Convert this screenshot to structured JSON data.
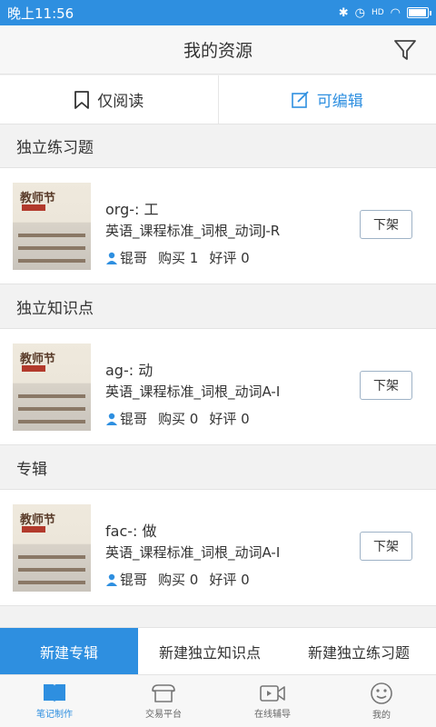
{
  "status_bar": {
    "time": "晚上11:56",
    "network": "HD"
  },
  "header": {
    "title": "我的资源"
  },
  "modes": [
    {
      "label": "仅阅读",
      "active": false
    },
    {
      "label": "可编辑",
      "active": true
    }
  ],
  "thumbnail": {
    "title_text": "教师节",
    "script_text": "节"
  },
  "sections": [
    {
      "title": "独立练习题",
      "items": [
        {
          "name": "org-: 工",
          "subtitle": "英语_课程标准_词根_动词J-R",
          "author": "锟哥",
          "purchases": "购买 1",
          "reviews": "好评 0",
          "button": "下架"
        }
      ]
    },
    {
      "title": "独立知识点",
      "items": [
        {
          "name": "ag-: 动",
          "subtitle": "英语_课程标准_词根_动词A-I",
          "author": "锟哥",
          "purchases": "购买 0",
          "reviews": "好评 0",
          "button": "下架"
        }
      ]
    },
    {
      "title": "专辑",
      "items": [
        {
          "name": "fac-: 做",
          "subtitle": "英语_课程标准_词根_动词A-I",
          "author": "锟哥",
          "purchases": "购买 0",
          "reviews": "好评 0",
          "button": "下架"
        }
      ]
    }
  ],
  "actions": [
    "新建专辑",
    "新建独立知识点",
    "新建独立练习题"
  ],
  "tabs": [
    {
      "label": "笔记制作",
      "icon": "book-icon",
      "active": true
    },
    {
      "label": "交易平台",
      "icon": "shop-icon",
      "active": false
    },
    {
      "label": "在线辅导",
      "icon": "video-icon",
      "active": false
    },
    {
      "label": "我的",
      "icon": "smiley-icon",
      "active": false
    }
  ],
  "colors": {
    "accent": "#2e8fe0",
    "background": "#f2f2f2"
  }
}
